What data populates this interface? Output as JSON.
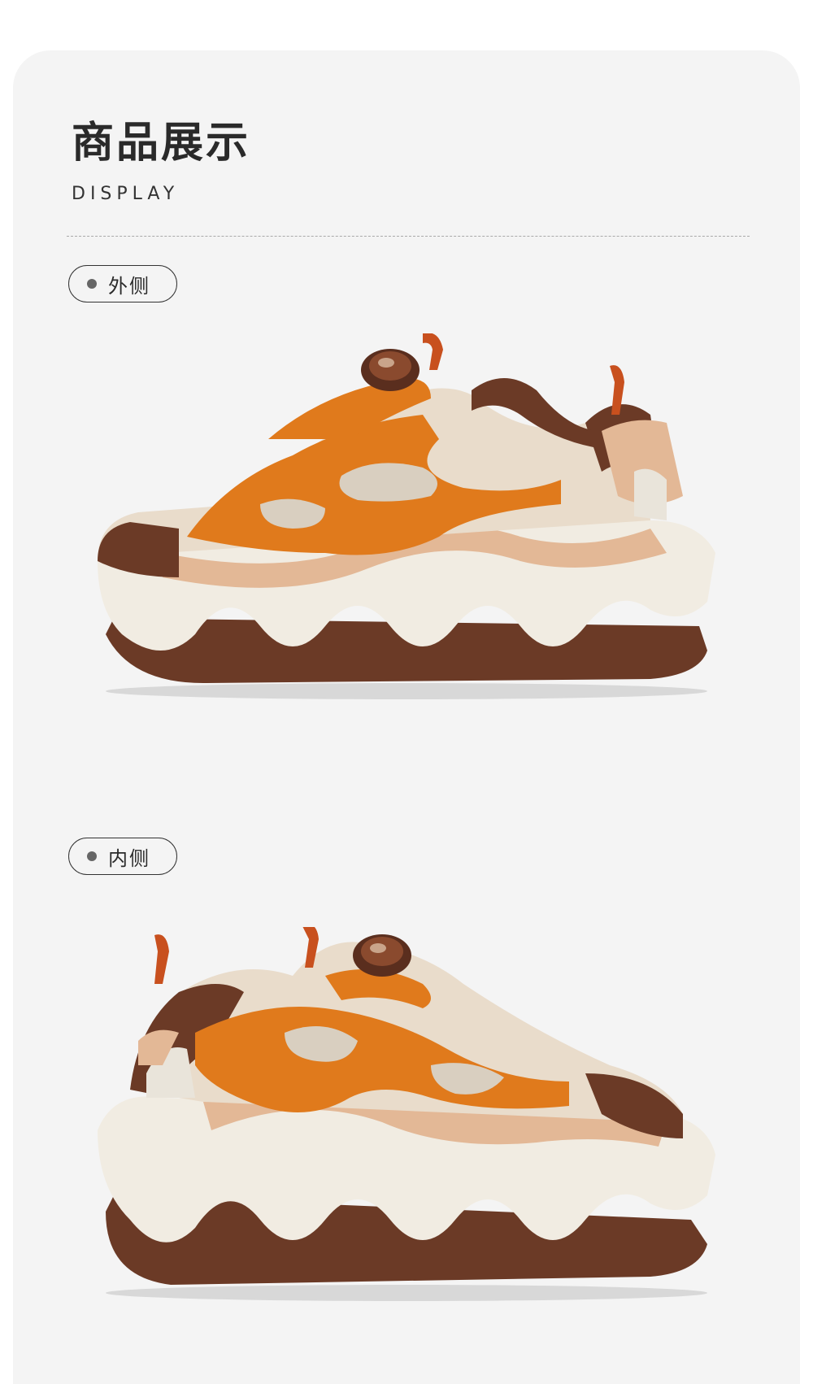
{
  "section": {
    "title": "商品展示",
    "subtitle": "DISPLAY"
  },
  "views": [
    {
      "label": "外侧",
      "image": "sneaker-lateral-view"
    },
    {
      "label": "内侧",
      "image": "sneaker-medial-view"
    }
  ],
  "colors": {
    "background": "#f4f4f4",
    "orange": "#e07a1c",
    "brown": "#6b3a26",
    "sole": "#f1ece2",
    "mesh": "#e9dccb",
    "tan": "#e3b896"
  }
}
